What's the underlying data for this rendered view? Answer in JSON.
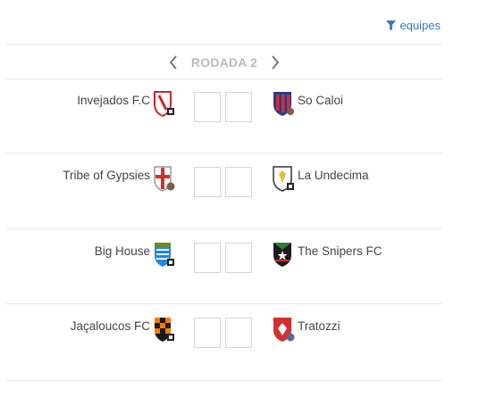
{
  "filter": {
    "label": "equipes",
    "icon": "filter-icon"
  },
  "round": {
    "label": "RODADA 2",
    "prev_icon": "chevron-left-icon",
    "next_icon": "chevron-right-icon"
  },
  "matches": [
    {
      "home": "Invejados F.C",
      "away": "So Caloi",
      "home_score": "",
      "away_score": ""
    },
    {
      "home": "Tribe of Gypsies",
      "away": "La Undecima",
      "home_score": "",
      "away_score": ""
    },
    {
      "home": "Big House",
      "away": "The Snipers FC",
      "home_score": "",
      "away_score": ""
    },
    {
      "home": "Jaçaloucos FC",
      "away": "Tratozzi",
      "home_score": "",
      "away_score": ""
    }
  ],
  "colors": {
    "accent": "#2f79c0",
    "muted": "#bbbbbb",
    "divider": "#e6e6e6"
  }
}
